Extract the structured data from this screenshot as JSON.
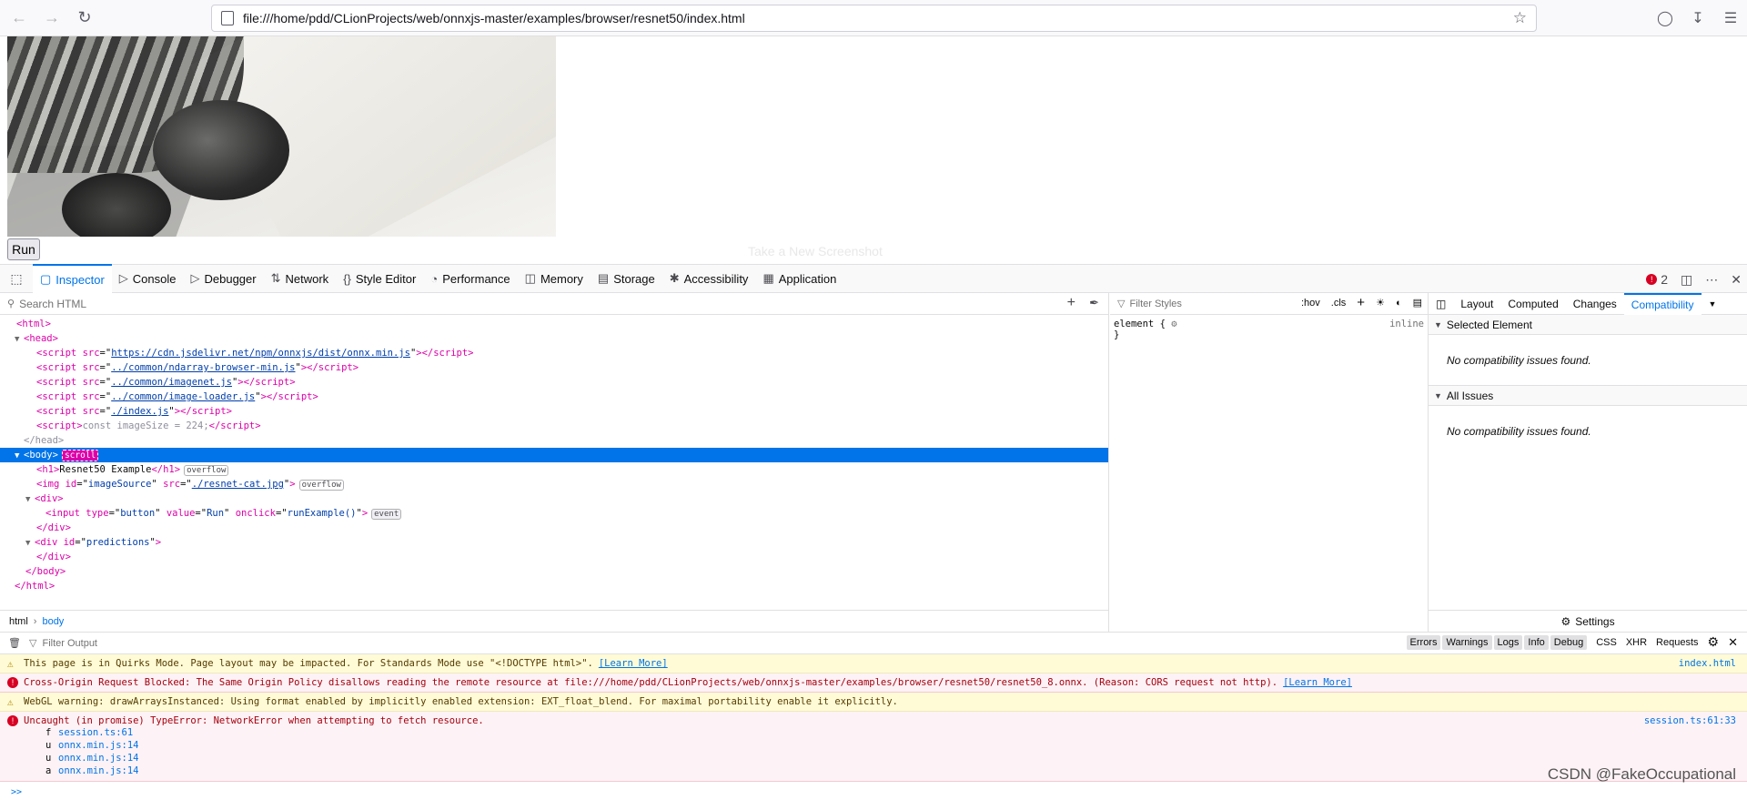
{
  "browser": {
    "url": "file:///home/pdd/CLionProjects/web/onnxjs-master/examples/browser/resnet50/index.html"
  },
  "page": {
    "run_label": "Run",
    "ghost_text": "Take a New Screenshot"
  },
  "devtools": {
    "tabs": [
      {
        "label": "Inspector",
        "icon": "inspector-icon"
      },
      {
        "label": "Console",
        "icon": "console-icon"
      },
      {
        "label": "Debugger",
        "icon": "debugger-icon"
      },
      {
        "label": "Network",
        "icon": "network-icon"
      },
      {
        "label": "Style Editor",
        "icon": "style-editor-icon"
      },
      {
        "label": "Performance",
        "icon": "performance-icon"
      },
      {
        "label": "Memory",
        "icon": "memory-icon"
      },
      {
        "label": "Storage",
        "icon": "storage-icon"
      },
      {
        "label": "Accessibility",
        "icon": "accessibility-icon"
      },
      {
        "label": "Application",
        "icon": "application-icon"
      }
    ],
    "error_count": "2",
    "search_placeholder": "Search HTML",
    "breadcrumbs": [
      "html",
      "body"
    ],
    "rules": {
      "filter_placeholder": "Filter Styles",
      "hov": ":hov",
      "cls": ".cls",
      "element_rule": "element {",
      "close": "}",
      "inline": "inline"
    },
    "sidebar": {
      "tabs": [
        "Layout",
        "Computed",
        "Changes",
        "Compatibility"
      ],
      "selected_element": "Selected Element",
      "all_issues": "All Issues",
      "no_issues": "No compatibility issues found.",
      "settings": "Settings"
    },
    "markup": {
      "html_open": "<html>",
      "head_open": "<head>",
      "head_close": "</head>",
      "body_close": "</body>",
      "html_close": "</html>",
      "div_close": "</div>",
      "script_src_1": "https://cdn.jsdelivr.net/npm/onnxjs/dist/onnx.min.js",
      "script_src_2": "../common/ndarray-browser-min.js",
      "script_src_3": "../common/imagenet.js",
      "script_src_4": "../common/image-loader.js",
      "script_src_5": "./index.js",
      "inline_script": "const imageSize = 224;",
      "h1_text": "Resnet50 Example",
      "img_id": "imageSource",
      "img_src": "./resnet-cat.jpg",
      "input_type": "button",
      "input_value": "Run",
      "input_onclick": "runExample()",
      "pred_id": "predictions",
      "badge_overflow": "overflow",
      "badge_event": "event",
      "badge_scroll": "scroll"
    }
  },
  "console": {
    "filter_placeholder": "Filter Output",
    "filters": [
      "Errors",
      "Warnings",
      "Logs",
      "Info",
      "Debug"
    ],
    "extra_filters": [
      "CSS",
      "XHR",
      "Requests"
    ],
    "messages": [
      {
        "type": "warn",
        "text": "This page is in Quirks Mode. Page layout may be impacted. For Standards Mode use \"<!DOCTYPE html>\".",
        "learn": "[Learn More]",
        "location": "index.html"
      },
      {
        "type": "err",
        "text": "Cross-Origin Request Blocked: The Same Origin Policy disallows reading the remote resource at file:///home/pdd/CLionProjects/web/onnxjs-master/examples/browser/resnet50/resnet50_8.onnx. (Reason: CORS request not http).",
        "learn": "[Learn More]",
        "location": ""
      },
      {
        "type": "warn",
        "text": "WebGL warning: drawArraysInstanced: Using format enabled by implicitly enabled extension: EXT_float_blend. For maximal portability enable it explicitly.",
        "learn": "",
        "location": ""
      },
      {
        "type": "err",
        "text": "Uncaught (in promise) TypeError: NetworkError when attempting to fetch resource.",
        "learn": "",
        "location": "session.ts:61:33"
      }
    ],
    "stack": [
      {
        "fn": "f",
        "file": "session.ts:61"
      },
      {
        "fn": "u",
        "file": "onnx.min.js:14"
      },
      {
        "fn": "u",
        "file": "onnx.min.js:14"
      },
      {
        "fn": "a",
        "file": "onnx.min.js:14"
      }
    ],
    "prompt": ">>"
  },
  "watermark": "CSDN @FakeOccupational"
}
